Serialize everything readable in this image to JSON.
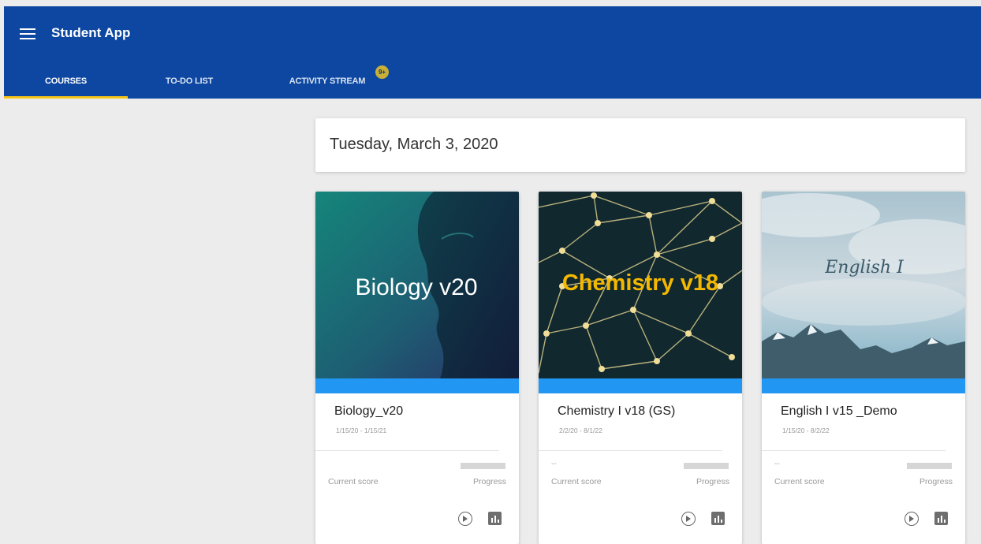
{
  "header": {
    "app_title": "Student App",
    "menu_icon": "hamburger-menu-icon",
    "brand_color": "#0d47a1",
    "tab_indicator_color": "#f5c518"
  },
  "tabs": [
    {
      "label": "COURSES",
      "active": true
    },
    {
      "label": "TO-DO LIST",
      "active": false
    },
    {
      "label": "ACTIVITY STREAM",
      "active": false,
      "badge": "9+"
    }
  ],
  "date_banner": {
    "text": "Tuesday, March 3, 2020"
  },
  "courses": [
    {
      "cover_text": "Biology v20",
      "name": "Biology_v20",
      "dates": "1/15/20 - 1/15/21",
      "score": "",
      "score_label": "Current score",
      "progress_label": "Progress",
      "accent_color": "#2196f3"
    },
    {
      "cover_text": "Chemistry v18",
      "name": "Chemistry I v18 (GS)",
      "dates": "2/2/20 - 8/1/22",
      "score": "--",
      "score_label": "Current score",
      "progress_label": "Progress",
      "accent_color": "#2196f3"
    },
    {
      "cover_text": "English I",
      "name": "English I v15 _Demo",
      "dates": "1/15/20 - 8/2/22",
      "score": "--",
      "score_label": "Current score",
      "progress_label": "Progress",
      "accent_color": "#2196f3"
    }
  ],
  "card_actions": {
    "play_icon": "play-circle-icon",
    "stats_icon": "bar-chart-icon"
  }
}
